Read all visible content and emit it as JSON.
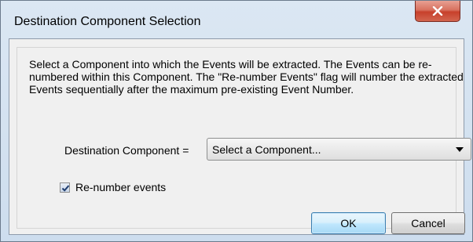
{
  "window": {
    "title": "Destination Component Selection",
    "close_icon": "close-icon"
  },
  "dialog": {
    "description": "Select a Component into which the Events will be extracted. The Events can be re-numbered within this Component. The \"Re-number Events\" flag will number the extracted Events sequentially after the maximum pre-existing Event Number.",
    "destination_label": "Destination Component =",
    "destination_select": {
      "selected": "Select a Component..."
    },
    "renumber_checkbox": {
      "label": "Re-number events",
      "checked": true
    },
    "buttons": {
      "ok": "OK",
      "cancel": "Cancel"
    }
  },
  "colors": {
    "title_bar": "#dbe7f3",
    "close_button": "#c7402b",
    "client_bg": "#f0f0f0",
    "ok_border": "#3c7fb1"
  }
}
